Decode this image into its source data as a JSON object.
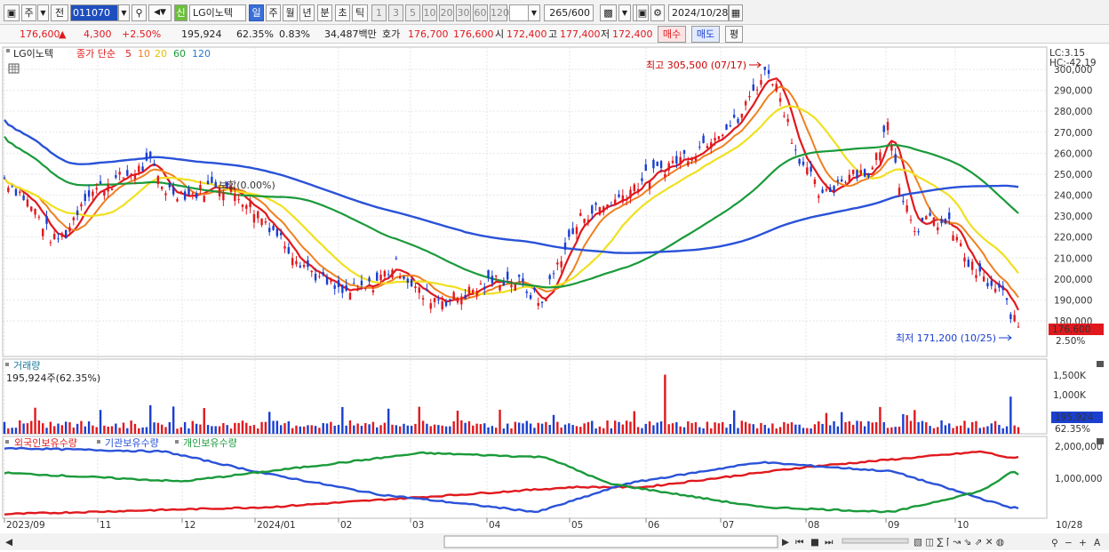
{
  "toolbar": {
    "market": "주",
    "prev": "전",
    "code": "011070",
    "badge": "신",
    "name": "LG이노텍",
    "periods": [
      "일",
      "주",
      "월",
      "년",
      "분",
      "초",
      "틱"
    ],
    "active_period": "일",
    "minutes": [
      "1",
      "3",
      "5",
      "10",
      "20",
      "30",
      "60",
      "120"
    ],
    "count": "265",
    "count_total": "/600",
    "date": "2024/10/28"
  },
  "pricebar": {
    "price": "176,600",
    "change": "4,300",
    "rate": "+2.50%",
    "volume": "195,924",
    "vol_ratio": "62.35%",
    "turnover": "0.83%",
    "amount": "34,487백만",
    "quote_label": "호가",
    "ask": "176,700",
    "bid": "176,600",
    "open_label": "시",
    "open": "172,400",
    "high_label": "고",
    "high": "177,400",
    "low_label": "저",
    "low": "172,400",
    "buy_btn": "매수",
    "sell_btn": "매도",
    "eval_btn": "평"
  },
  "price_chart": {
    "legend_name": "LG이노텍",
    "legend_type": "종가 단순",
    "ma_periods": [
      "5",
      "10",
      "20",
      "60",
      "120"
    ],
    "ma_colors": [
      "#e0191e",
      "#f08020",
      "#f0e020",
      "#1a9a3a",
      "#2a52d8"
    ],
    "lc": "LC:3.15",
    "hc": "HC:-42.19",
    "high_note": "최고 305,500 (07/17)",
    "low_note": "최저 171,200 (10/25)",
    "flat_note": "보합(0.00%)",
    "y_ticks": [
      "300,000",
      "290,000",
      "280,000",
      "270,000",
      "260,000",
      "250,000",
      "240,000",
      "230,000",
      "220,000",
      "210,000",
      "200,000",
      "190,000",
      "180,000"
    ],
    "last_price": "176,600",
    "last_rate": "2.50%"
  },
  "volume_chart": {
    "title": "거래량",
    "sub": "195,924주(62.35%)",
    "y_ticks": [
      "1,500K",
      "1,000K"
    ],
    "last": "195,924",
    "last_rate": "62.35%"
  },
  "holdings_chart": {
    "legend": [
      "외국인보유수량",
      "기관보유수량",
      "개인보유수량"
    ],
    "colors": [
      "#e0191e",
      "#2a52d8",
      "#1a9a3a"
    ],
    "y_ticks": [
      "2,000,000",
      "1,000,000"
    ]
  },
  "x_axis": {
    "labels": [
      "2023/09",
      "11",
      "12",
      "2024/01",
      "02",
      "03",
      "04",
      "05",
      "06",
      "07",
      "08",
      "09",
      "10"
    ],
    "end_label": "10/28"
  }
}
